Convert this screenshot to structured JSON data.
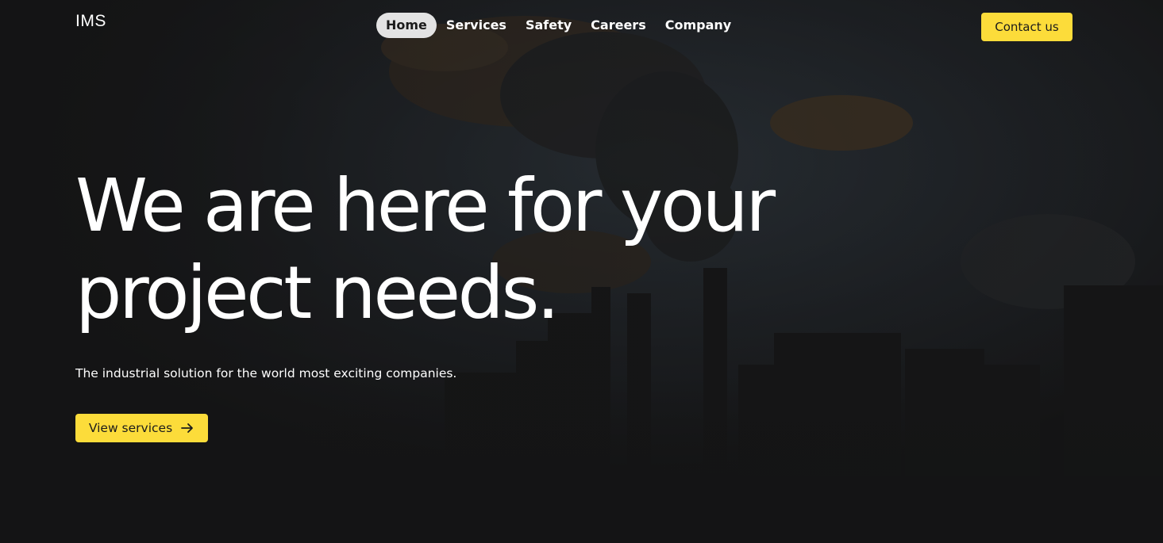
{
  "brand": {
    "logo_text": "IMS"
  },
  "nav": {
    "items": [
      {
        "label": "Home",
        "active": true
      },
      {
        "label": "Services",
        "active": false
      },
      {
        "label": "Safety",
        "active": false
      },
      {
        "label": "Careers",
        "active": false
      },
      {
        "label": "Company",
        "active": false
      }
    ]
  },
  "header": {
    "contact_label": "Contact us"
  },
  "hero": {
    "headline_line1": "We are here for your",
    "headline_line2": "project needs.",
    "subtitle": "The industrial solution for the world most exciting companies.",
    "cta_label": "View services",
    "cta_icon": "arrow-right-icon",
    "background_image": "industrial-smokestack-photo"
  },
  "colors": {
    "accent": "#fcdc3a",
    "background": "#1b1b1c",
    "nav_active_bg": "#e3e3e3",
    "text": "#ffffff"
  }
}
